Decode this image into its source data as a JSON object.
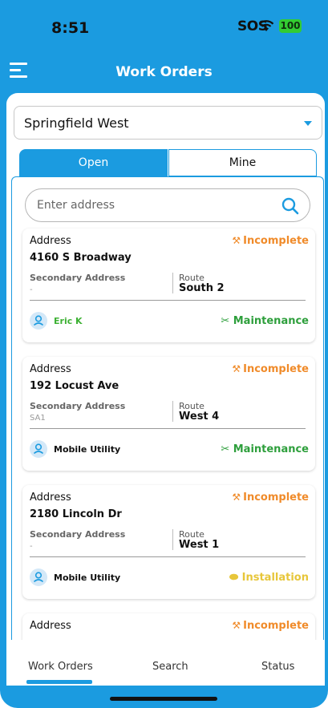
{
  "status_bar": {
    "time": "8:51",
    "sos": "SOS",
    "battery": "100"
  },
  "header": {
    "title": "Work Orders"
  },
  "location_select": {
    "value": "Springfield West"
  },
  "tabs": [
    {
      "label": "Open"
    },
    {
      "label": "Mine"
    }
  ],
  "search": {
    "placeholder": "Enter address"
  },
  "cards": [
    {
      "address_label": "Address",
      "status": "Incomplete",
      "street": "4160 S Broadway",
      "secondary_label": "Secondary Address",
      "secondary_value": "-",
      "route_label": "Route",
      "route_value": "South 2",
      "assignee": "Eric K",
      "type": "Maintenance"
    },
    {
      "address_label": "Address",
      "status": "Incomplete",
      "street": "192 Locust Ave",
      "secondary_label": "Secondary Address",
      "secondary_value": "SA1",
      "route_label": "Route",
      "route_value": "West 4",
      "assignee": "Mobile Utility",
      "type": "Maintenance"
    },
    {
      "address_label": "Address",
      "status": "Incomplete",
      "street": "2180 Lincoln Dr",
      "secondary_label": "Secondary Address",
      "secondary_value": "-",
      "route_label": "Route",
      "route_value": "West 1",
      "assignee": "Mobile Utility",
      "type": "Installation"
    },
    {
      "address_label": "Address",
      "status": "Incomplete"
    }
  ],
  "bottom_nav": [
    {
      "label": "Work Orders"
    },
    {
      "label": "Search"
    },
    {
      "label": "Status"
    }
  ],
  "colors": {
    "primary": "#1b9be0",
    "incomplete": "#f08b2a",
    "maintenance": "#2e9f3c",
    "installation": "#e7c63a",
    "assignee_green": "#3db134"
  },
  "icons": {
    "status": "wrench-clock-icon",
    "maintenance": "tools-icon",
    "installation": "pipe-icon",
    "assignee": "user-icon",
    "search": "search-icon",
    "menu": "hamburger-icon"
  }
}
